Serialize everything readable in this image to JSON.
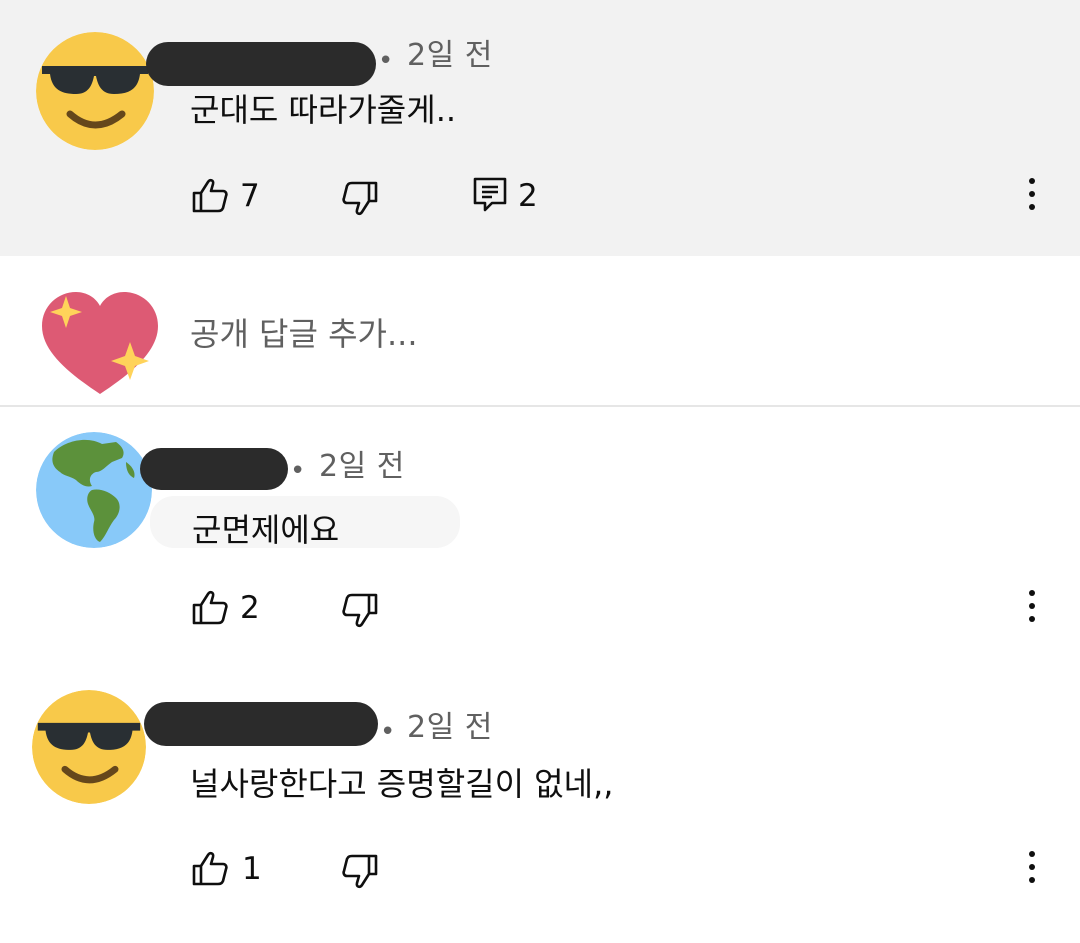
{
  "comments": [
    {
      "avatar_icon": "sunglasses-face-icon",
      "time": "2일 전",
      "separator": "•",
      "text": "군대도 따라가줄게..",
      "likes": "7",
      "replies": "2"
    },
    {
      "avatar_icon": "globe-americas-icon",
      "time": "2일 전",
      "separator": "•",
      "text": "군면제에요",
      "likes": "2"
    },
    {
      "avatar_icon": "sunglasses-face-icon",
      "time": "2일 전",
      "separator": "•",
      "text": "널사랑한다고 증명할길이 없네,,",
      "likes": "1"
    }
  ],
  "reply_box": {
    "avatar_icon": "sparkling-heart-icon",
    "placeholder": "공개 답글 추가..."
  },
  "colors": {
    "highlight_bg": "#f2f2f2",
    "secondary_text": "#606060",
    "primary_text": "#0f0f0f",
    "redaction": "#2b2b2b"
  }
}
